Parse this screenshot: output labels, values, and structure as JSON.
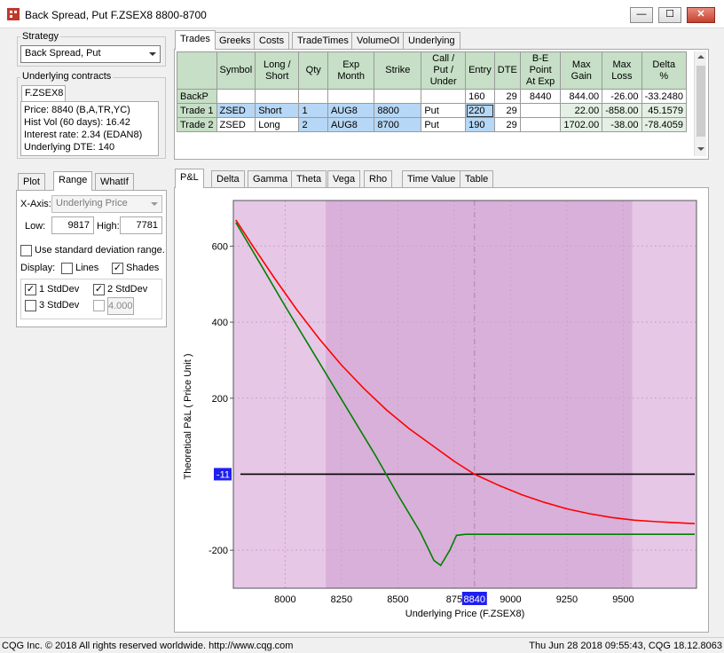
{
  "window": {
    "title": "Back Spread, Put F.ZSEX8 8800-8700",
    "min_label": "—",
    "max_label": "☐",
    "close_label": "✕"
  },
  "strategy": {
    "label": "Strategy",
    "value": "Back Spread, Put"
  },
  "underlying": {
    "label": "Underlying contracts",
    "symbol": "F.ZSEX8",
    "lines": [
      "Price: 8840 (B,A,TR,YC)",
      "Hist Vol (60 days): 16.42",
      "Interest rate: 2.34 (EDAN8)",
      "Underlying DTE: 140"
    ]
  },
  "left_tabs": [
    "Plot",
    "Range",
    "WhatIf"
  ],
  "range": {
    "xaxis_label": "X-Axis:",
    "xaxis_value": "Underlying Price",
    "low_label": "Low:",
    "low_value": "9817",
    "high_label": "High:",
    "high_value": "7781",
    "use_std_label": "Use standard deviation range.",
    "use_std_checked": false,
    "display_label": "Display:",
    "lines_label": "Lines",
    "lines_checked": false,
    "shades_label": "Shades",
    "shades_checked": true,
    "std1_label": "1 StdDev",
    "std1_checked": true,
    "std2_label": "2 StdDev",
    "std2_checked": true,
    "std3_label": "3 StdDev",
    "std3_checked": false,
    "custom_std_value": "4.000"
  },
  "top_tabs": [
    "Trades",
    "Greeks",
    "Costs",
    "TradeTimes",
    "VolumeOI",
    "Underlying"
  ],
  "trades_table": {
    "headers": [
      "Symbol",
      "Long /\nShort",
      "Qty",
      "Exp\nMonth",
      "Strike",
      "Call / Put /\nUnder",
      "Entry",
      "DTE",
      "B-E Point\nAt Exp",
      "Max\nGain",
      "Max\nLoss",
      "Delta\n%"
    ],
    "rows": [
      {
        "name": "BackP",
        "cells": [
          "",
          "",
          "",
          "",
          "",
          "",
          "160",
          "29",
          "8440",
          "844.00",
          "-26.00",
          "-33.2480"
        ]
      },
      {
        "name": "Trade 1",
        "cells": [
          "ZSED",
          "Short",
          "1",
          "AUG8",
          "8800",
          "Put",
          "220",
          "29",
          "",
          "22.00",
          "-858.00",
          "45.1579"
        ]
      },
      {
        "name": "Trade 2",
        "cells": [
          "ZSED",
          "Long",
          "2",
          "AUG8",
          "8700",
          "Put",
          "190",
          "29",
          "",
          "1702.00",
          "-38.00",
          "-78.4059"
        ]
      }
    ]
  },
  "chart_tabs": [
    "P&L",
    "Delta",
    "Gamma",
    "Theta",
    "Vega",
    "Rho",
    "Time Value",
    "Table"
  ],
  "chart_data": {
    "type": "line",
    "xlabel": "Underlying Price (F.ZSEX8)",
    "ylabel": "Theoretical P&L  ( Price Unit )",
    "xlim": [
      7770,
      9825
    ],
    "ylim": [
      -300,
      720
    ],
    "x_ticks": [
      8000,
      8250,
      8500,
      8750,
      9000,
      9250,
      9500
    ],
    "x_tick_labels": [
      "8000",
      "8250",
      "8500",
      "875",
      "9000",
      "9250",
      "9500"
    ],
    "y_ticks": [
      600,
      400,
      200,
      -200
    ],
    "current_price_label": "8840",
    "current_price": 8840,
    "zero_line_label": "-11",
    "zero_line_value": 0,
    "shade_1std": [
      8180,
      9540
    ],
    "colors": {
      "theoretical": "#ff0000",
      "expiration": "#008000",
      "zero": "#000000",
      "shade_outer": "#e6c7e6",
      "shade_inner": "#d9b0d9",
      "marker": "#1f1ff0"
    },
    "series": [
      {
        "x": [
          7781,
          7850,
          7950,
          8050,
          8150,
          8250,
          8350,
          8450,
          8550,
          8650,
          8750,
          8840,
          8950,
          9050,
          9150,
          9250,
          9350,
          9450,
          9550,
          9650,
          9750,
          9817
        ],
        "values": [
          669,
          606,
          518,
          434,
          357,
          287,
          225,
          169,
          120,
          77,
          34,
          0,
          -30,
          -54,
          -74,
          -91,
          -104,
          -114,
          -121,
          -125,
          -128,
          -130
        ]
      },
      {
        "x": [
          7781,
          7900,
          8000,
          8100,
          8200,
          8300,
          8400,
          8500,
          8600,
          8660,
          8690,
          8730,
          8760,
          8800,
          8900,
          9000,
          9200,
          9400,
          9600,
          9817
        ],
        "values": [
          662,
          543,
          442,
          344,
          246,
          148,
          50,
          -54,
          -153,
          -227,
          -240,
          -200,
          -161,
          -158,
          -158,
          -158,
          -158,
          -158,
          -158,
          -158
        ]
      }
    ]
  },
  "status": {
    "left": "CQG Inc. © 2018 All rights reserved worldwide. http://www.cqg.com",
    "right": "Thu Jun 28 2018 09:55:43, CQG 18.12.8063"
  }
}
